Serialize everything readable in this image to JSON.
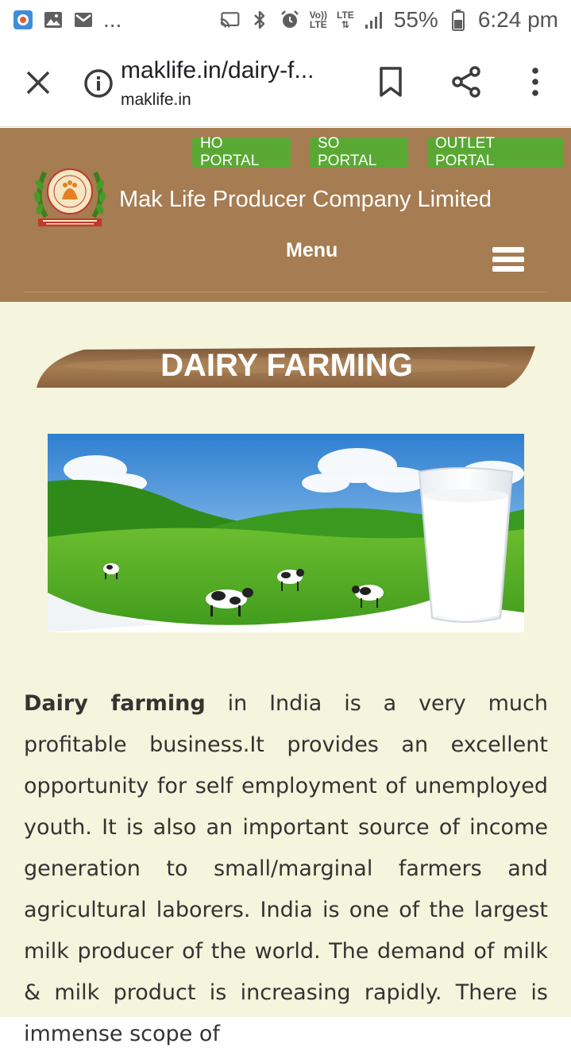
{
  "status_bar": {
    "battery": "55%",
    "time": "6:24 pm",
    "dots": "...",
    "volte_top": "Vo))",
    "volte_bottom": "LTE",
    "lte": "LTE"
  },
  "toolbar": {
    "url": "maklife.in/dairy-f...",
    "domain": "maklife.in"
  },
  "header": {
    "portals": [
      "HO PORTAL",
      "SO PORTAL",
      "OUTLET PORTAL"
    ],
    "company_name": "Mak Life Producer Company Limited",
    "menu_label": "Menu"
  },
  "content": {
    "banner_title": "DAIRY FARMING",
    "article_bold": "Dairy farming",
    "article_text": " in India is a very much profitable business.It provides an excellent opportunity for self employment of unemployed youth. It is also an important source of income generation to small/marginal farmers and agricultural laborers.  India is one of the largest milk producer of the world. The demand of milk & milk product is increasing rapidly. There is immense scope of"
  },
  "colors": {
    "header_brown": "#a67c52",
    "portal_green": "#5aa834",
    "content_bg": "#f5f4dc"
  }
}
